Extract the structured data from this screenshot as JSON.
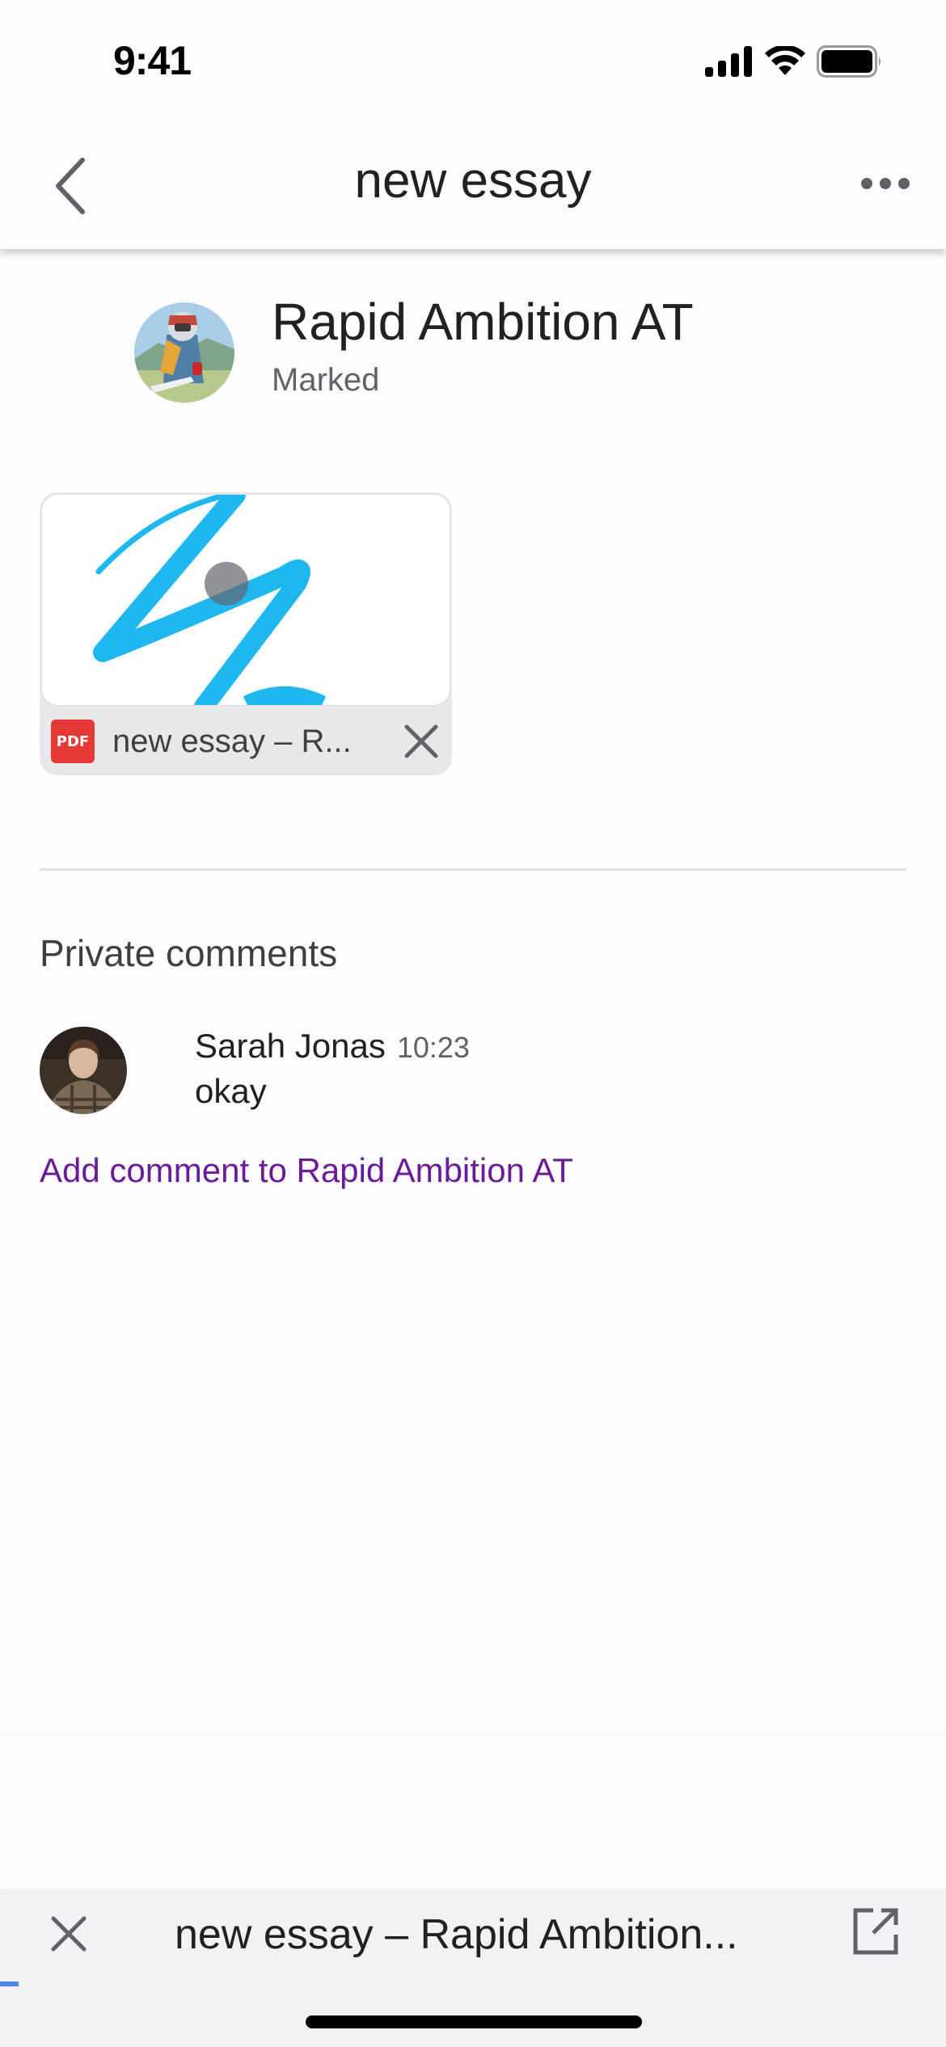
{
  "status_bar": {
    "time": "9:41",
    "icons": [
      "cellular-signal-icon",
      "wifi-icon",
      "battery-icon"
    ]
  },
  "nav": {
    "back_icon": "chevron-left-icon",
    "title": "new essay",
    "more_icon": "more-horizontal-icon"
  },
  "student": {
    "name": "Rapid Ambition AT",
    "status": "Marked",
    "avatar": "motocross-rider-avatar"
  },
  "attachment": {
    "type_badge": "PDF",
    "name": "new essay – R...",
    "remove_icon": "close-icon",
    "colors": {
      "scribble": "#1eb7f0",
      "pdf_badge": "#e53935"
    }
  },
  "comments": {
    "section_title": "Private comments",
    "items": [
      {
        "author": "Sarah Jonas",
        "time": "10:23",
        "text": "okay",
        "avatar": "user-portrait-avatar"
      }
    ],
    "add_comment_label": "Add comment to Rapid Ambition AT",
    "link_color": "#6a1b9a"
  },
  "doc_bar": {
    "close_icon": "close-icon",
    "title": "new essay – Rapid Ambition...",
    "open_icon": "open-in-new-icon",
    "progress_fraction": 0.02
  }
}
